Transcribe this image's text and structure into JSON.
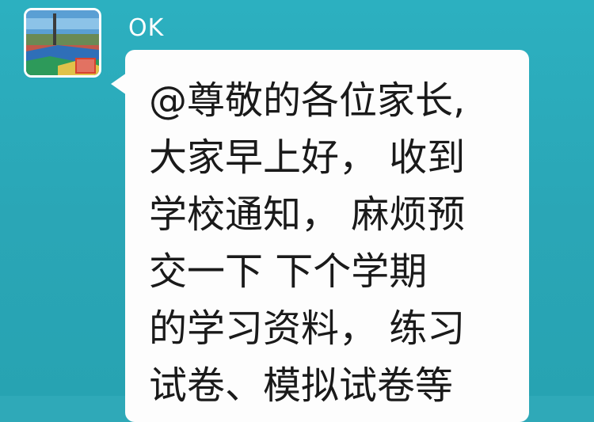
{
  "chat": {
    "sender_name": "OK",
    "message_lines": [
      "@尊敬的各位家长,",
      "大家早上好， 收到",
      "学校通知， 麻烦预",
      "交一下 下个学期",
      "的学习资料， 练习",
      "试卷、模拟试卷等"
    ]
  },
  "colors": {
    "chat_background": "#2aa8b8",
    "bubble_background": "#fdfdfd",
    "text": "#1a1a1a",
    "sender_name": "#ffffff"
  },
  "icons": {
    "avatar": "avatar-image-icon"
  }
}
